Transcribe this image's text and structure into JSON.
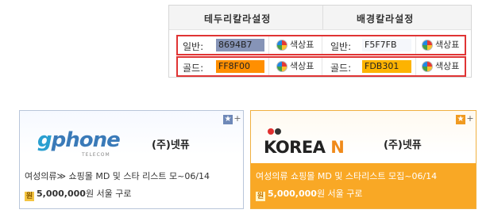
{
  "color_settings": {
    "headers": [
      "테두리칼라설정",
      "배경칼라설정"
    ],
    "rows": [
      {
        "label_left": "일반:",
        "value_left": "8694B7",
        "color_left": "#8694B7",
        "label_right": "일반:",
        "value_right": "F5F7FB",
        "color_right": "#F5F7FB",
        "swatch_label": "색상표"
      },
      {
        "label_left": "골드:",
        "value_left": "FF8F00",
        "color_left": "#FF8F00",
        "label_right": "골드:",
        "value_right": "FDB301",
        "color_right": "#FDB301",
        "swatch_label": "색상표"
      }
    ],
    "highlight_color": "#E03434"
  },
  "cards": [
    {
      "logo_text_g": "g",
      "logo_text_rest": "phone",
      "logo_subtext": "TELECOM",
      "company": "(주)넷퓨",
      "title": "여성의류≫ 쇼핑몰 MD 및 스타 리스트 모~06/14",
      "won_icon": "원",
      "amount": "5,000,000",
      "amount_suffix": "원 서울 구로",
      "style": "normal"
    },
    {
      "logo_text_main": "KOREA",
      "logo_text_accent": "N",
      "company": "(주)넷퓨",
      "title": "여성의류 쇼핑몰 MD 및 스타리스트 모집~06/14",
      "won_icon": "원",
      "amount": "5,000,000",
      "amount_suffix": "원 서울 구로",
      "style": "gold"
    }
  ],
  "corner_icons": {
    "star": "★",
    "plus": "+"
  }
}
